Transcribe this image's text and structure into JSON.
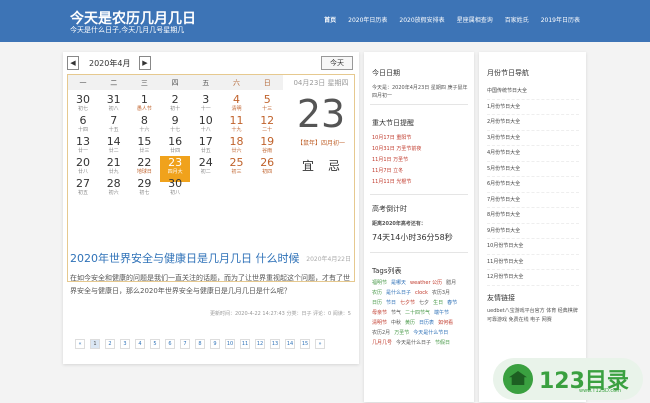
{
  "header": {
    "title": "今天是农历几月几日",
    "subtitle": "今天是什么日子,今天几月几号星期几",
    "nav": [
      "首页",
      "2020年日历表",
      "2020放假安排表",
      "星座属相查询",
      "百家姓氏",
      "2019年日历表"
    ]
  },
  "calendar": {
    "month_label": "2020年4月",
    "prev": "◀",
    "next": "▶",
    "today_btn": "今天",
    "weekdays": [
      "一",
      "二",
      "三",
      "四",
      "五",
      "六",
      "日"
    ],
    "rows": [
      [
        {
          "n": "30",
          "l": "初七"
        },
        {
          "n": "31",
          "l": "初八"
        },
        {
          "n": "1",
          "l": "愚人节"
        },
        {
          "n": "2",
          "l": "初十"
        },
        {
          "n": "3",
          "l": "十一"
        },
        {
          "n": "4",
          "l": "清明"
        },
        {
          "n": "5",
          "l": "十三"
        }
      ],
      [
        {
          "n": "6",
          "l": "十四"
        },
        {
          "n": "7",
          "l": "十五"
        },
        {
          "n": "8",
          "l": "十六"
        },
        {
          "n": "9",
          "l": "十七"
        },
        {
          "n": "10",
          "l": "十八"
        },
        {
          "n": "11",
          "l": "十九"
        },
        {
          "n": "12",
          "l": "二十"
        }
      ],
      [
        {
          "n": "13",
          "l": "廿一"
        },
        {
          "n": "14",
          "l": "廿二"
        },
        {
          "n": "15",
          "l": "廿三"
        },
        {
          "n": "16",
          "l": "廿四"
        },
        {
          "n": "17",
          "l": "廿五"
        },
        {
          "n": "18",
          "l": "廿六"
        },
        {
          "n": "19",
          "l": "谷雨"
        }
      ],
      [
        {
          "n": "20",
          "l": "廿八"
        },
        {
          "n": "21",
          "l": "廿九"
        },
        {
          "n": "22",
          "l": "地球日"
        },
        {
          "n": "23",
          "l": "四月大"
        },
        {
          "n": "24",
          "l": "初二"
        },
        {
          "n": "25",
          "l": "初三"
        },
        {
          "n": "26",
          "l": "初四"
        }
      ],
      [
        {
          "n": "27",
          "l": "初五"
        },
        {
          "n": "28",
          "l": "初六"
        },
        {
          "n": "29",
          "l": "初七"
        },
        {
          "n": "30",
          "l": "初八"
        },
        {
          "n": "",
          "l": ""
        },
        {
          "n": "",
          "l": ""
        },
        {
          "n": "",
          "l": ""
        }
      ]
    ],
    "detail": {
      "date": "04月23日 星期四",
      "day": "23",
      "lunar": "【鼠年】四月初一",
      "yi": "宜",
      "ji": "忌"
    }
  },
  "article": {
    "title": "2020年世界安全与健康日是几月几日 什么时候",
    "date": "2020年4月22日",
    "body": "在如今安全和健康的问题是我们一直关注的话题，而为了让世界重视起这个问题，才有了世界安全与健康日，那么2020年世界安全与健康日是几月几日是什么呢？",
    "meta": "更新时间：2020-4-22  14:27:43    分类：日子    评论：0    阅读：5",
    "pages": [
      "«",
      "1",
      "2",
      "3",
      "4",
      "5",
      "6",
      "7",
      "8",
      "9",
      "10",
      "11",
      "12",
      "13",
      "14",
      "15",
      "»"
    ]
  },
  "sidebar": {
    "today_title": "今日日期",
    "today_text": "今天是：2020年4月23日 星期四 庚子鼠年 四月初一",
    "fest_title": "重大节日提醒",
    "festivals": [
      "10月17日 重阳节",
      "10月31日 万圣节前夜",
      "11月1日 万圣节",
      "11月7日 立冬",
      "11月11日 光棍节"
    ],
    "exam_title": "高考倒计时",
    "exam_label": "距离2020年高考还有：",
    "exam_value": "74天14小时36分58秒",
    "tags_title": "Tags列表",
    "tags": [
      "福明节",
      "是哪天",
      "weather 公历",
      "腊月",
      "农历",
      "是什么日子",
      "clock",
      "农历3月",
      "日历",
      "节日",
      "七夕节",
      "七夕",
      "生日",
      "春节",
      "母亲节",
      "节气",
      "二十四节气",
      "端午节",
      "清明节",
      "中秋",
      "黄历",
      "日历表",
      "如何看",
      "农历2月",
      "万圣节",
      "今天是什么节日",
      "几月几号",
      "今天是什么日子",
      "节假日"
    ]
  },
  "sidebar2": {
    "title": "月份节日导航",
    "months": [
      "中国传统节日大全",
      "1月份节日大全",
      "2月份节日大全",
      "3月份节日大全",
      "4月份节日大全",
      "5月份节日大全",
      "6月份节日大全",
      "7月份节日大全",
      "8月份节日大全",
      "9月份节日大全",
      "10月份节日大全",
      "11月份节日大全",
      "12月份节日大全"
    ],
    "friend_title": "友情链接",
    "friend_text": "uedbet八宝游戏平台官方 体育 经典棋牌 可靠游戏 免费在线 电子 网赛"
  },
  "logo": {
    "text": "123目录",
    "url": "www.T123D.com"
  }
}
